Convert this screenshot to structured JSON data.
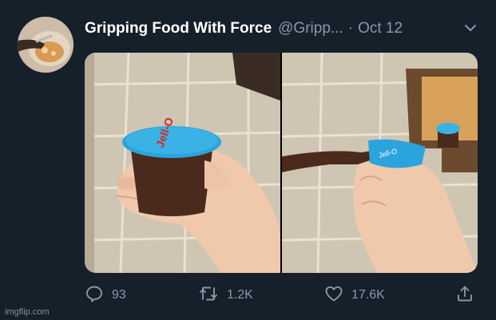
{
  "tweet": {
    "display_name": "Gripping Food With Force",
    "handle": "@Gripp...",
    "separator": "·",
    "date": "Oct 12",
    "actions": {
      "replies": "93",
      "retweets": "1.2K",
      "likes": "17.6K"
    }
  },
  "media": {
    "photo_left": {
      "cup_label": "Jell-O"
    },
    "photo_right": {
      "cup_label": "Jell-O"
    }
  },
  "icons": [
    "avatar",
    "chevron-down-icon",
    "reply-icon",
    "retweet-icon",
    "like-icon",
    "share-icon"
  ],
  "colors": {
    "background": "#15202b",
    "secondary_text": "#8899a6",
    "cup_lid": "#2aa4dd",
    "pudding": "#4a2a1c"
  },
  "watermark": "imgflip.com"
}
